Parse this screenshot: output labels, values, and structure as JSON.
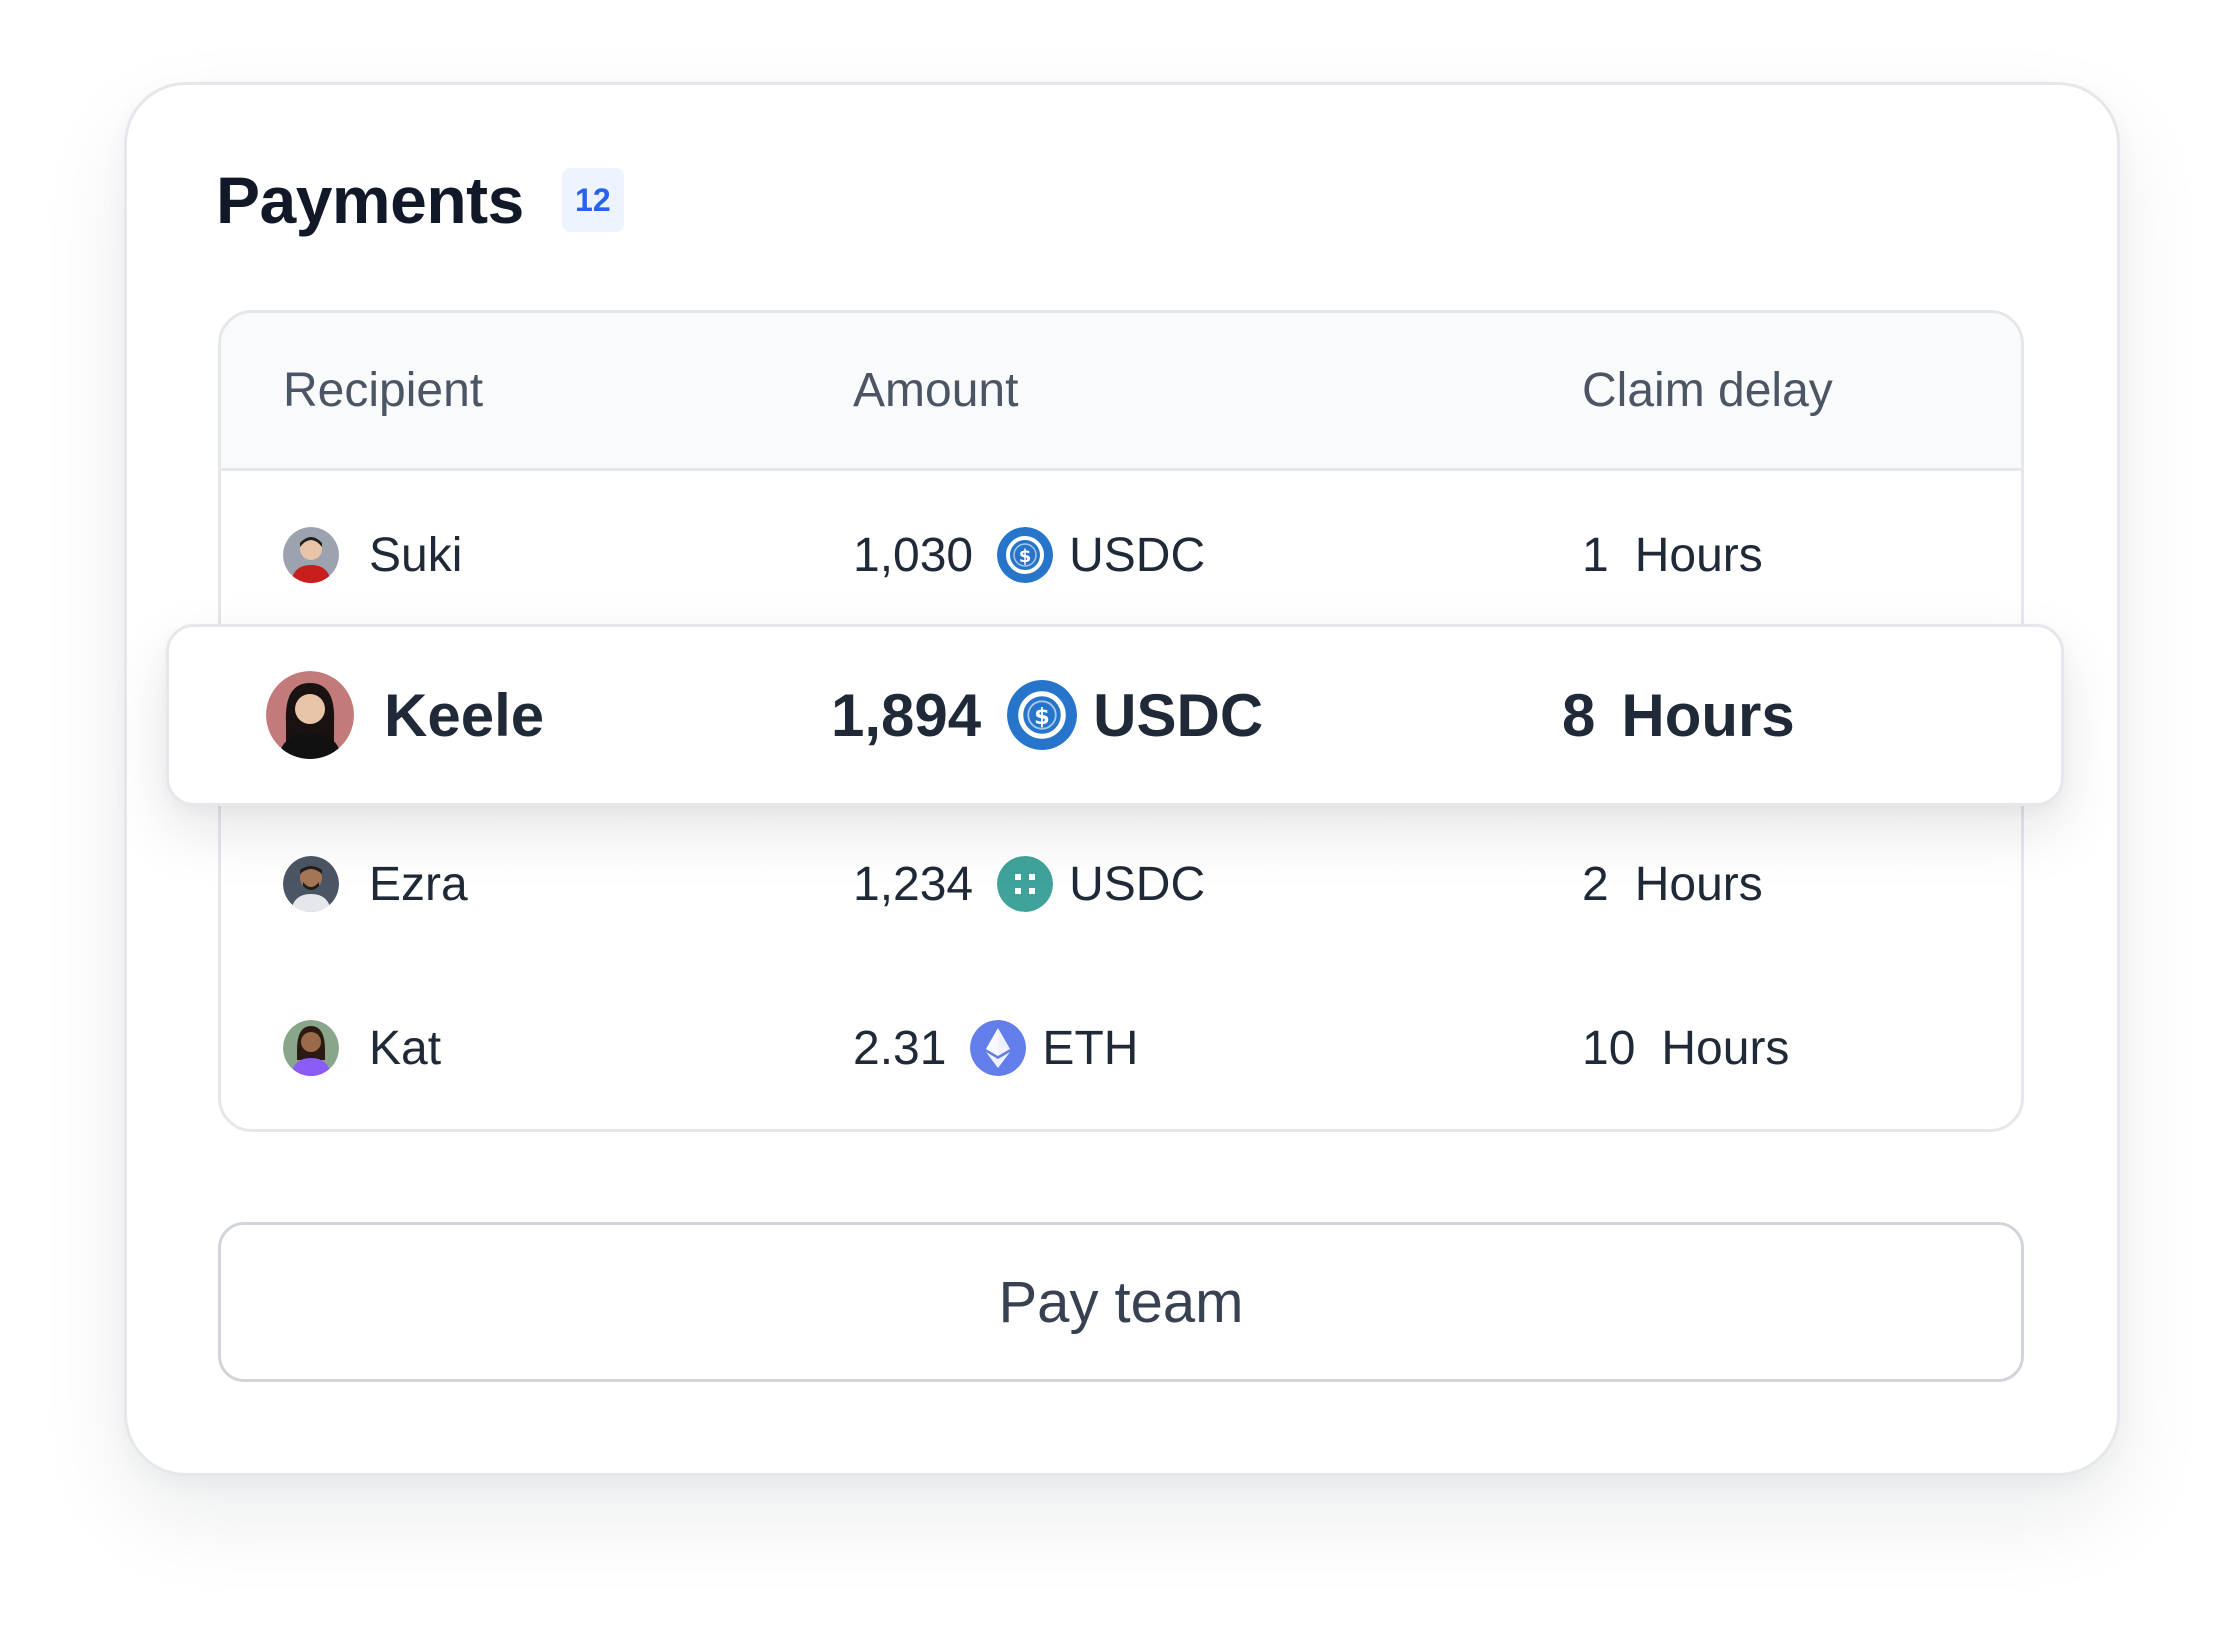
{
  "header": {
    "title": "Payments",
    "count": "12"
  },
  "table": {
    "columns": [
      "Recipient",
      "Amount",
      "Claim delay"
    ],
    "rows": [
      {
        "recipient": "Suki",
        "amount": "1,030",
        "token": "USDC",
        "token_icon": "usdc-icon",
        "delay_value": "1",
        "delay_unit": "Hours",
        "avatar_color": "#9ca3af"
      },
      {
        "recipient": "Keele",
        "amount": "1,894",
        "token": "USDC",
        "token_icon": "usdc-icon",
        "delay_value": "8",
        "delay_unit": "Hours",
        "avatar_color": "#c27a7a",
        "highlighted": true
      },
      {
        "recipient": "Ezra",
        "amount": "1,234",
        "token": "USDC",
        "token_icon": "usdc-teal-icon",
        "delay_value": "2",
        "delay_unit": "Hours",
        "avatar_color": "#4b5563"
      },
      {
        "recipient": "Kat",
        "amount": "2.31",
        "token": "ETH",
        "token_icon": "eth-icon",
        "delay_value": "10",
        "delay_unit": "Hours",
        "avatar_color": "#8aa68a"
      }
    ]
  },
  "actions": {
    "pay_label": "Pay team"
  },
  "colors": {
    "usdc": "#2775ca",
    "usdc_teal": "#3fa39a",
    "eth": "#627eea",
    "badge_text": "#2563eb",
    "badge_bg": "#eef4ff"
  }
}
